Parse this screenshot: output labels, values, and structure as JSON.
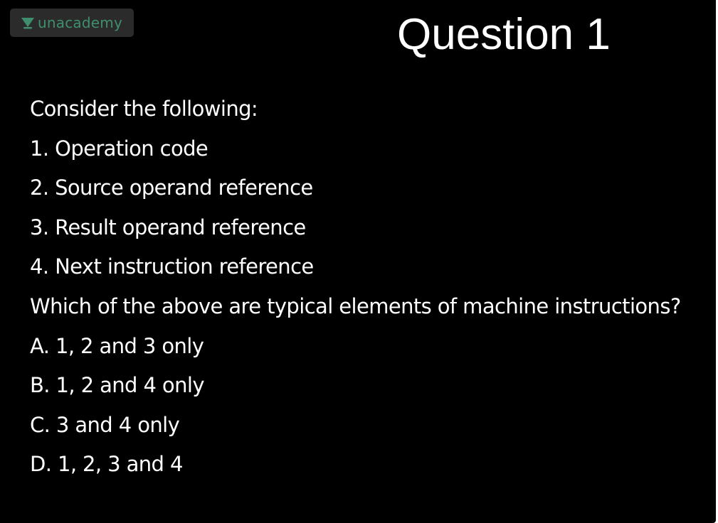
{
  "logo": {
    "text": "unacademy",
    "icon": "unacademy-logo-icon",
    "color": "#3f8f6e"
  },
  "slide": {
    "title": "Question 1",
    "background": "#000000",
    "text_color": "#ffffff",
    "lines": [
      "Consider the following:",
      "1. Operation code",
      "2. Source operand reference",
      "3. Result operand reference",
      "4. Next instruction reference",
      "Which of the above are typical elements of machine instructions?",
      "A. 1, 2 and 3 only",
      "B. 1, 2 and 4 only",
      "C. 3 and 4 only",
      "D. 1, 2, 3 and 4"
    ]
  }
}
